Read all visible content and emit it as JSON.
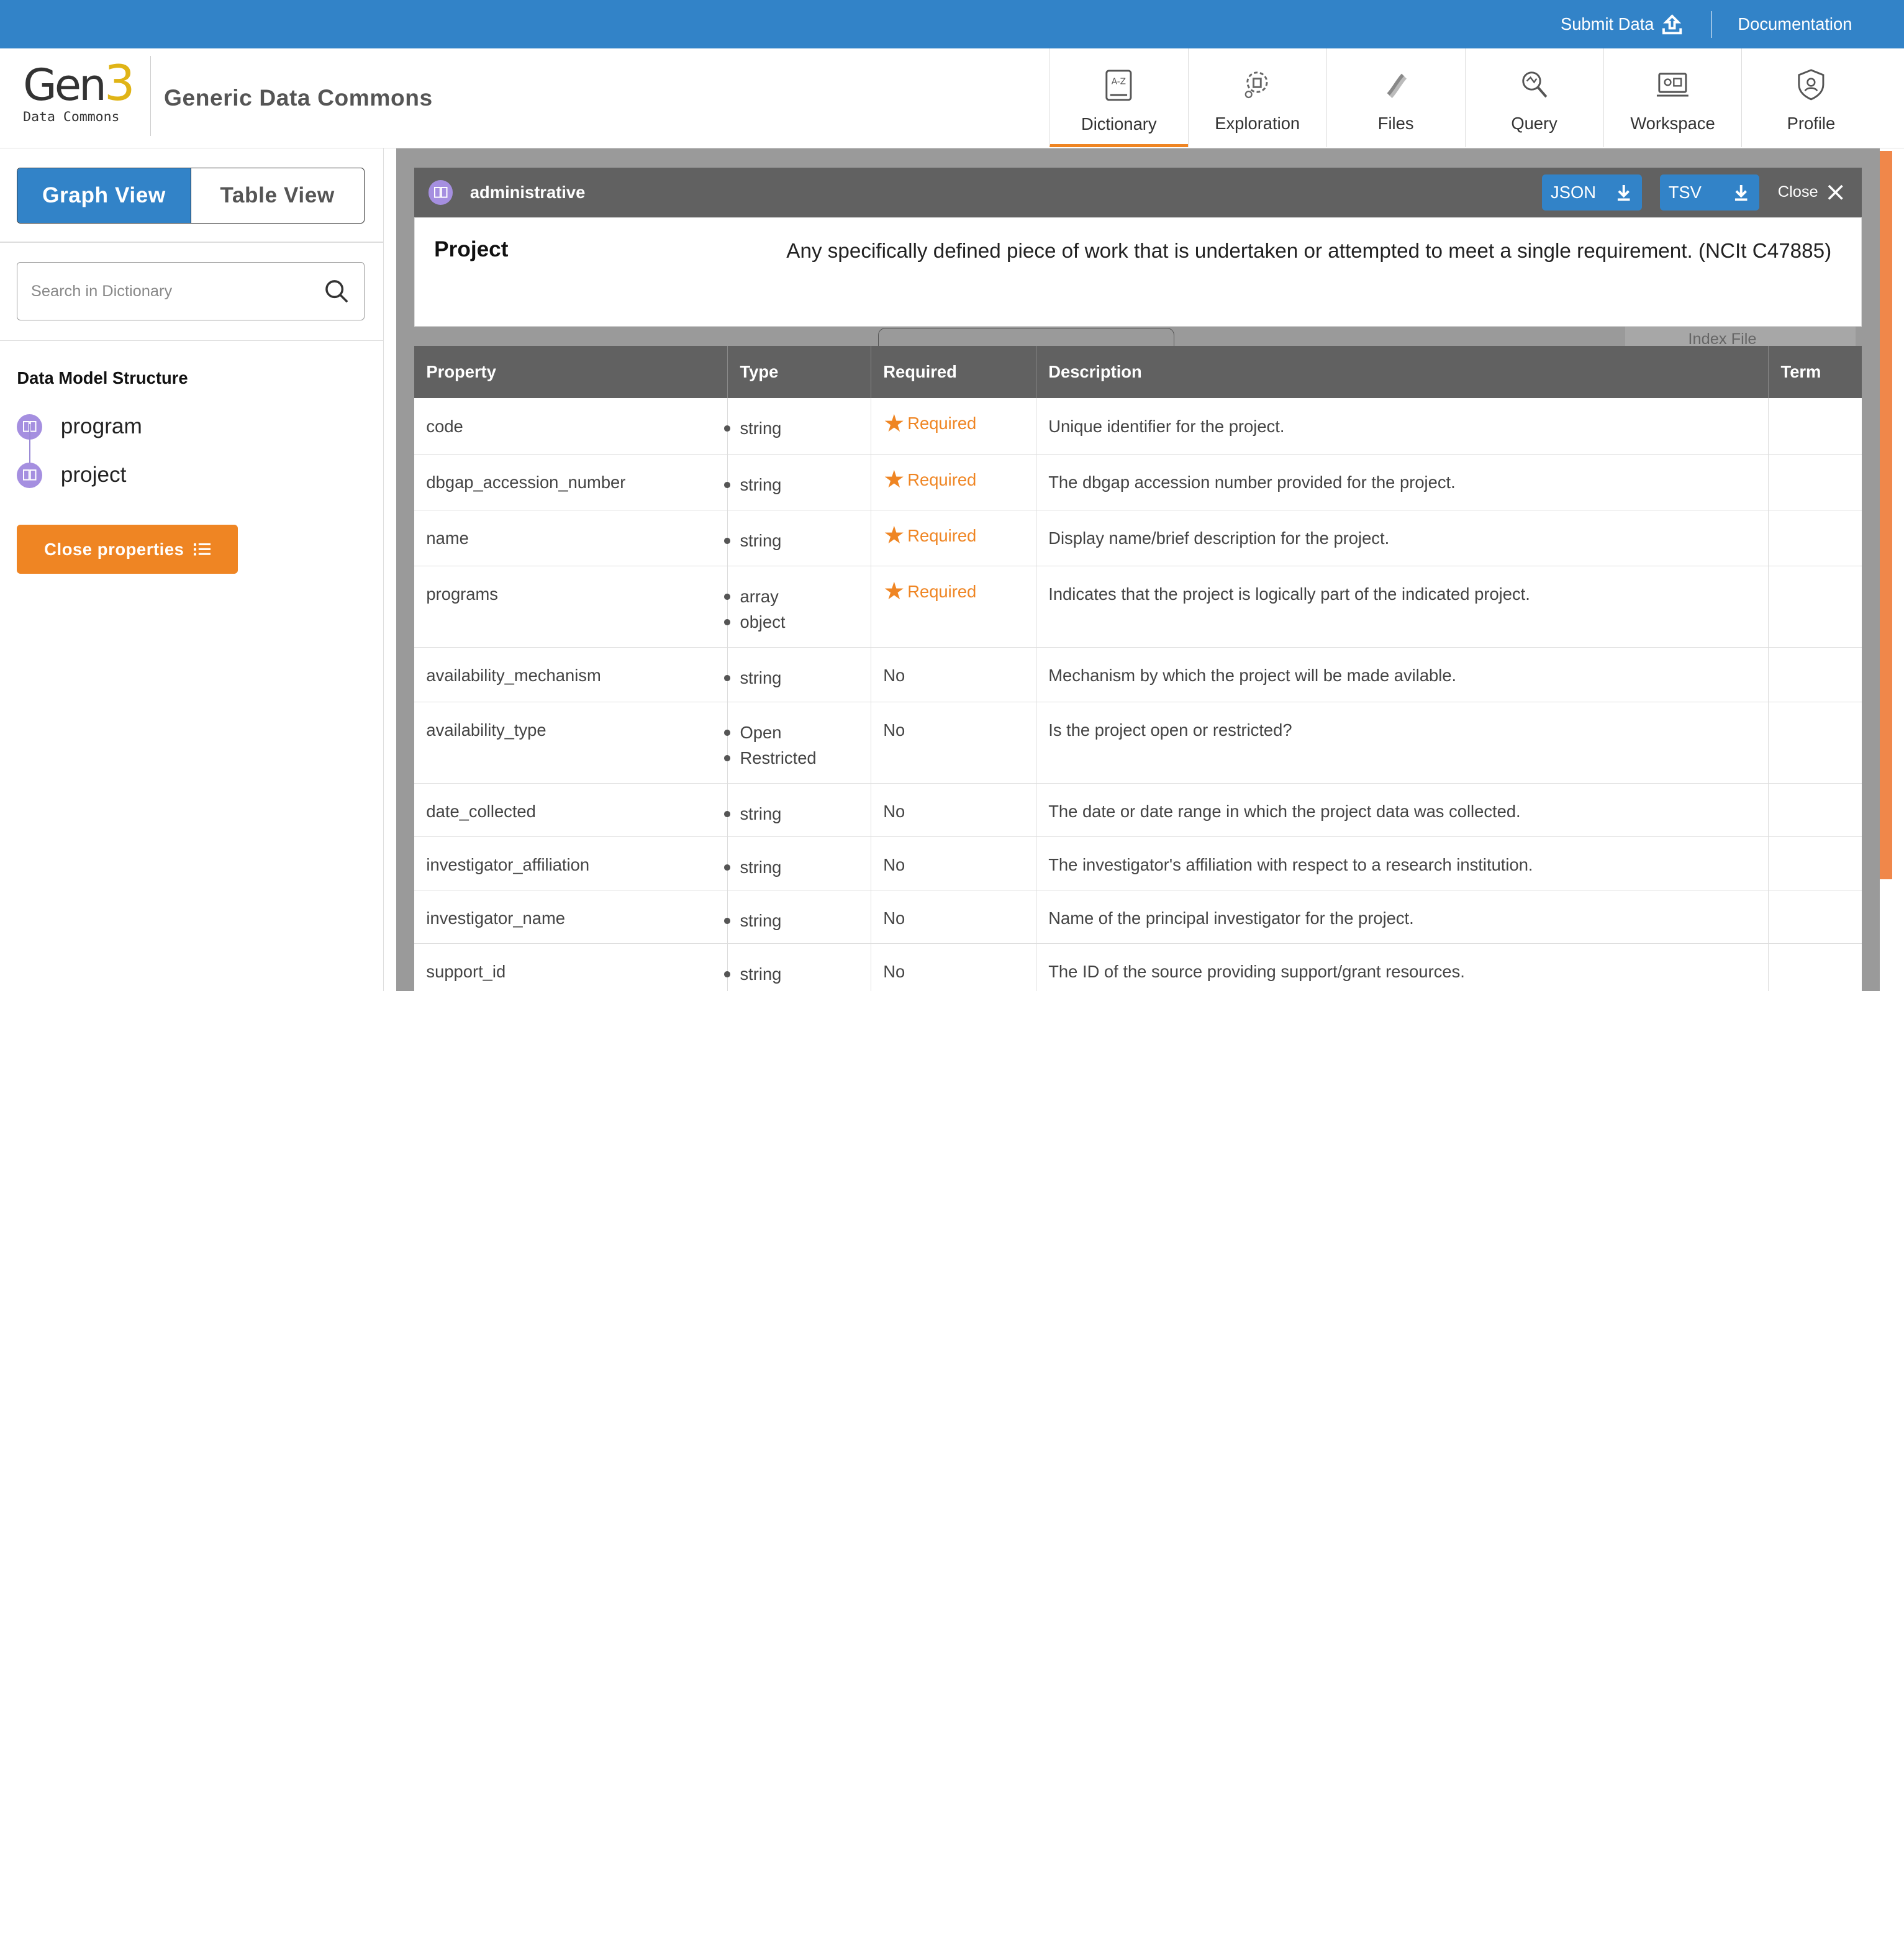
{
  "topbar": {
    "submit_label": "Submit Data",
    "docs_label": "Documentation"
  },
  "logo": {
    "gen": "Gen",
    "three": "3",
    "subtitle": "Data Commons"
  },
  "header": {
    "title": "Generic Data Commons"
  },
  "nav": [
    {
      "label": "Dictionary",
      "icon": "dictionary-icon"
    },
    {
      "label": "Exploration",
      "icon": "exploration-icon"
    },
    {
      "label": "Files",
      "icon": "files-icon"
    },
    {
      "label": "Query",
      "icon": "query-icon"
    },
    {
      "label": "Workspace",
      "icon": "workspace-icon"
    },
    {
      "label": "Profile",
      "icon": "profile-icon"
    }
  ],
  "sidebar": {
    "graph_view": "Graph View",
    "table_view": "Table View",
    "search_placeholder": "Search in Dictionary",
    "structure_title": "Data Model Structure",
    "tree": [
      "program",
      "project"
    ],
    "close_properties": "Close properties"
  },
  "panel": {
    "category": "administrative",
    "json_label": "JSON",
    "tsv_label": "TSV",
    "close_label": "Close",
    "node_name": "Project",
    "node_description": "Any specifically defined piece of work that is undertaken or attempted to meet a single requirement. (NCIt C47885)",
    "ghost_label": "Index File"
  },
  "table": {
    "headers": [
      "Property",
      "Type",
      "Required",
      "Description",
      "Term"
    ],
    "rows": [
      {
        "property": "code",
        "types": [
          "string"
        ],
        "required": "Required",
        "description": "Unique identifier for the project."
      },
      {
        "property": "dbgap_accession_number",
        "types": [
          "string"
        ],
        "required": "Required",
        "description": "The dbgap accession number provided for the project."
      },
      {
        "property": "name",
        "types": [
          "string"
        ],
        "required": "Required",
        "description": "Display name/brief description for the project."
      },
      {
        "property": "programs",
        "types": [
          "array",
          "object"
        ],
        "required": "Required",
        "description": "Indicates that the project is logically part of the indicated project."
      },
      {
        "property": "availability_mechanism",
        "types": [
          "string"
        ],
        "required": "No",
        "description": "Mechanism by which the project will be made avilable."
      },
      {
        "property": "availability_type",
        "types": [
          "Open",
          "Restricted"
        ],
        "required": "No",
        "description": "Is the project open or restricted?"
      },
      {
        "property": "date_collected",
        "types": [
          "string"
        ],
        "required": "No",
        "description": "The date or date range in which the project data was collected."
      },
      {
        "property": "investigator_affiliation",
        "types": [
          "string"
        ],
        "required": "No",
        "description": "The investigator's affiliation with respect to a research institution."
      },
      {
        "property": "investigator_name",
        "types": [
          "string"
        ],
        "required": "No",
        "description": "Name of the principal investigator for the project."
      },
      {
        "property": "support_id",
        "types": [
          "string"
        ],
        "required": "No",
        "description": "The ID of the source providing support/grant resources."
      }
    ]
  },
  "colors": {
    "brand_blue": "#3283c8",
    "accent_orange": "#ef8523",
    "node_purple": "#a58fe0",
    "panel_gray": "#616161"
  }
}
